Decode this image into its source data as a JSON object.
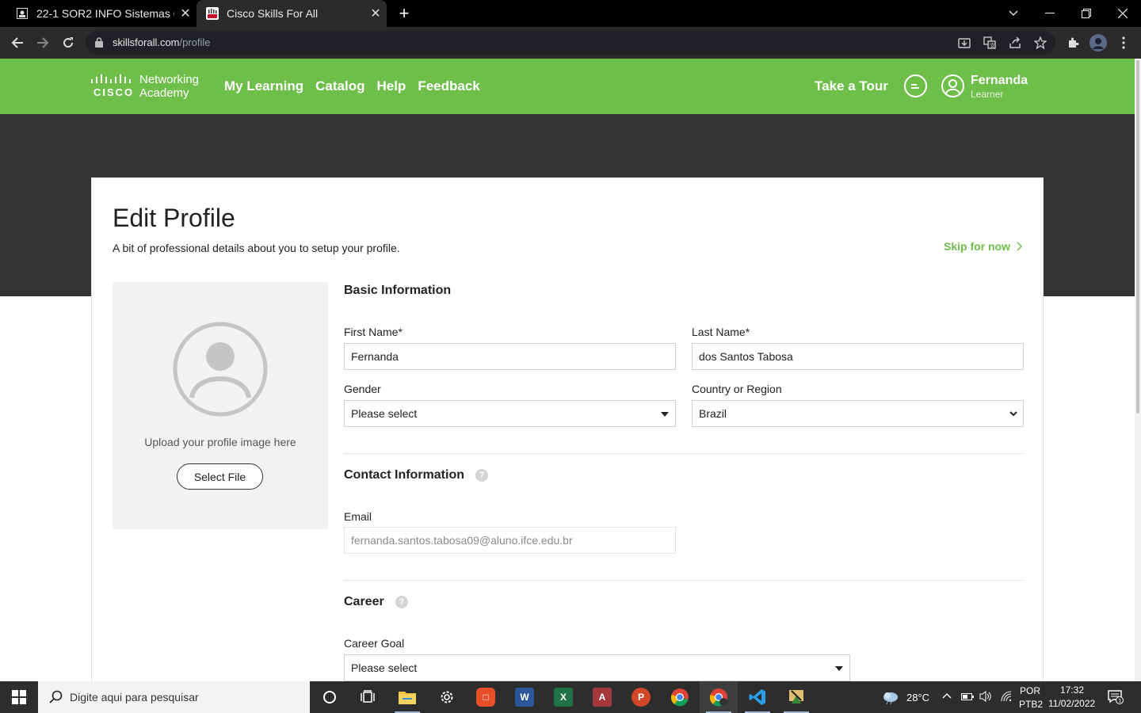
{
  "browser": {
    "tabs": [
      {
        "title": "22-1 SOR2 INFO Sistemas O",
        "active": false
      },
      {
        "title": "Cisco Skills For All",
        "active": true
      }
    ],
    "url_host": "skillsforall.com",
    "url_path": "/profile"
  },
  "site": {
    "logo_line1": "Networking",
    "logo_line2": "Academy",
    "logo_word": "CISCO",
    "nav": [
      "My Learning",
      "Catalog",
      "Help",
      "Feedback"
    ],
    "take_tour": "Take a Tour",
    "user_name": "Fernanda",
    "user_role": "Learner",
    "accent": "#6ebe4a"
  },
  "profile": {
    "title": "Edit Profile",
    "subtitle": "A bit of professional details about you to setup your profile.",
    "skip": "Skip for now",
    "upload_text": "Upload your profile image here",
    "select_file": "Select File",
    "basic_heading": "Basic Information",
    "first_name_label": "First Name*",
    "first_name_value": "Fernanda",
    "last_name_label": "Last Name*",
    "last_name_value": "dos Santos Tabosa",
    "gender_label": "Gender",
    "gender_value": "Please select",
    "country_label": "Country or Region",
    "country_value": "Brazil",
    "contact_heading": "Contact Information",
    "email_label": "Email",
    "email_value": "fernanda.santos.tabosa09@aluno.ifce.edu.br",
    "career_heading": "Career",
    "career_goal_label": "Career Goal",
    "career_goal_value": "Please select"
  },
  "taskbar": {
    "search_placeholder": "Digite aqui para pesquisar",
    "weather": "28°C",
    "lang1": "POR",
    "lang2": "PTB2",
    "time": "17:32",
    "date": "11/02/2022"
  }
}
